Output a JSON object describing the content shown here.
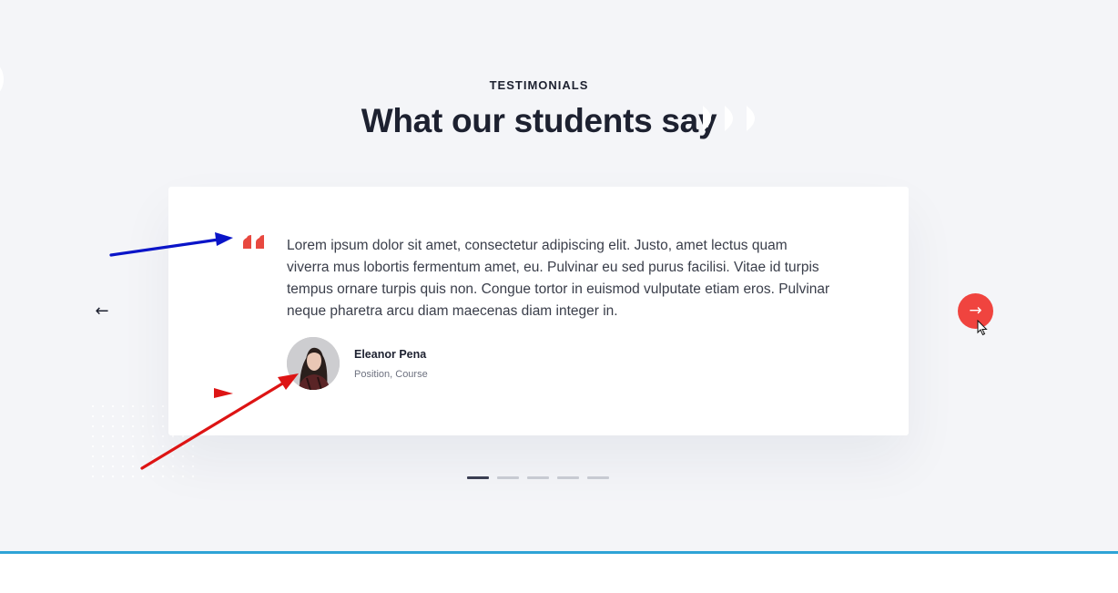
{
  "section": {
    "eyebrow": "TESTIMONIALS",
    "title": "What our students say"
  },
  "testimonial": {
    "text": "Lorem ipsum dolor sit amet, consectetur adipiscing elit. Justo, amet lectus quam viverra mus lobortis fermentum amet, eu. Pulvinar eu sed purus facilisi. Vitae id turpis tempus ornare turpis quis non. Congue tortor in euismod vulputate etiam eros. Pulvinar neque pharetra arcu diam maecenas diam integer in.",
    "author_name": "Eleanor Pena",
    "author_role": "Position, Course"
  },
  "navigation": {
    "prev_icon": "←",
    "next_icon": "→",
    "slide_count": 5,
    "active_slide": 1
  },
  "colors": {
    "accent": "#f0443f",
    "background": "#f4f5f8",
    "heading": "#1d2130",
    "annotation_blue": "#0a14c8",
    "annotation_red": "#dd1414",
    "rule": "#2ea3d6"
  },
  "icons": {
    "quote": "quote-icon",
    "prev": "arrow-left-icon",
    "next": "arrow-right-icon",
    "cursor": "cursor-icon"
  }
}
